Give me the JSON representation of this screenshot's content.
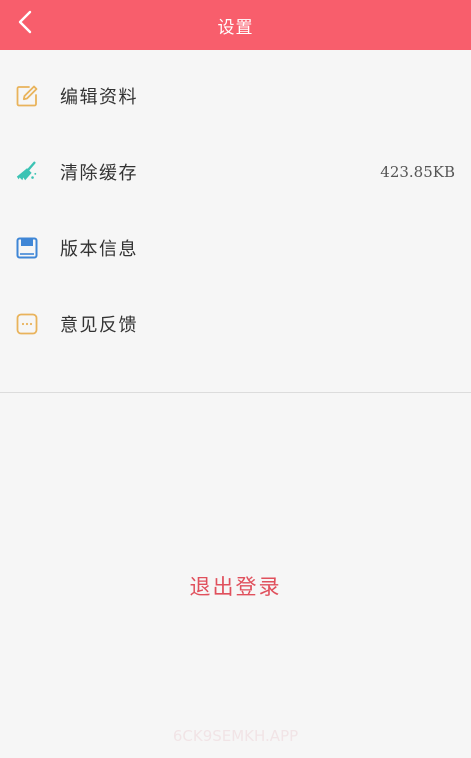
{
  "header": {
    "title": "设置",
    "back_icon": "chevron-left-icon",
    "background": "#f85e6c"
  },
  "menu": {
    "items": [
      {
        "label": "编辑资料",
        "icon": "edit-icon",
        "icon_color": "#e9b35b",
        "value": ""
      },
      {
        "label": "清除缓存",
        "icon": "broom-icon",
        "icon_color": "#3cc3b4",
        "value": "423.85KB"
      },
      {
        "label": "版本信息",
        "icon": "floppy-icon",
        "icon_color": "#3f86d6",
        "value": ""
      },
      {
        "label": "意见反馈",
        "icon": "feedback-icon",
        "icon_color": "#e9b35b",
        "value": ""
      }
    ]
  },
  "logout": {
    "label": "退出登录",
    "color": "#e0505c"
  },
  "watermark": {
    "text": "6CK9SEMKH.APP"
  }
}
